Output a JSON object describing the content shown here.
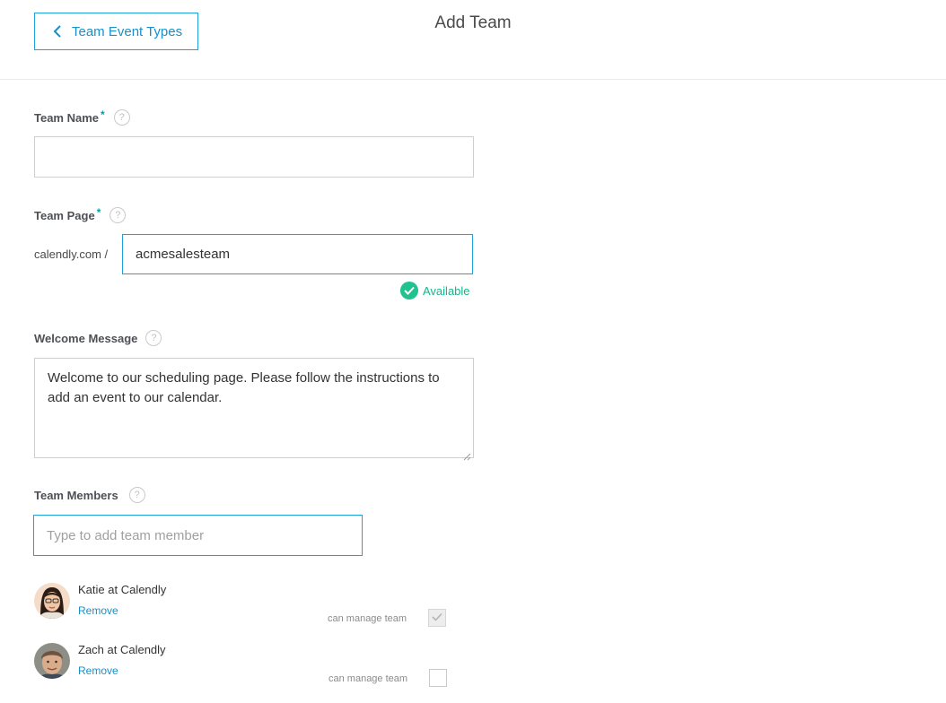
{
  "header": {
    "back_label": "Team Event Types",
    "title": "Add Team"
  },
  "form": {
    "team_name": {
      "label": "Team Name",
      "required_mark": "*",
      "help": "?",
      "value": ""
    },
    "team_page": {
      "label": "Team Page",
      "required_mark": "*",
      "help": "?",
      "prefix": "calendly.com /",
      "value": "acmesalesteam",
      "status": "Available"
    },
    "welcome_message": {
      "label": "Welcome Message",
      "help": "?",
      "value": "Welcome to our scheduling page. Please follow the instructions to add an event to our calendar."
    },
    "team_members": {
      "label": "Team Members",
      "help": "?",
      "placeholder": "Type to add team member"
    }
  },
  "members": [
    {
      "name": "Katie at Calendly",
      "remove_label": "Remove",
      "manage_label": "can manage team",
      "can_manage": true
    },
    {
      "name": "Zach at Calendly",
      "remove_label": "Remove",
      "manage_label": "can manage team",
      "can_manage": false
    }
  ],
  "colors": {
    "accent": "#1ea2dc",
    "success": "#1ec38f",
    "link": "#1a8fc8"
  },
  "icons": {
    "back": "chevron-left-icon",
    "help": "help-icon",
    "available": "check-circle-icon",
    "manage": "checkmark-icon"
  }
}
